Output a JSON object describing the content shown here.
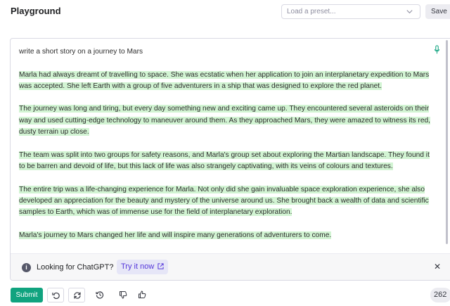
{
  "header": {
    "title": "Playground",
    "preset_placeholder": "Load a preset...",
    "save_label": "Save"
  },
  "editor": {
    "prompt": "write a short story on a journey to Mars",
    "paragraphs": [
      "Marla had always dreamt of travelling to space. She was ecstatic when her application to join an interplanetary expedition to Mars was accepted. She left Earth with a group of five adventurers in a ship that was designed to explore the red planet.",
      "The journey was long and tiring, but every day something new and exciting came up. They encountered several asteroids on their way and used cutting-edge technology to maneuver around them. As they approached Mars, they were amazed to witness its red, dusty terrain up close.",
      "The team was split into two groups for safety reasons, and Marla's group set about exploring the Martian landscape. They found it to be barren and devoid of life, but this lack of life was also strangely captivating, with its veins of colours and textures.",
      "The entire trip was a life-changing experience for Marla. Not only did she gain invaluable space exploration experience, she also developed an appreciation for the beauty and mystery of the universe around us. She brought back a wealth of data and scientific samples to Earth, which was of immense use for the field of interplanetary exploration.",
      "Marla's journey to Mars changed her life and will inspire many generations of adventurers to come."
    ],
    "highlight_color": "#d2f4d3"
  },
  "banner": {
    "text": "Looking for ChatGPT?",
    "link_label": "Try it now"
  },
  "footer": {
    "submit_label": "Submit",
    "token_count": "262"
  },
  "colors": {
    "accent": "#10a37f",
    "link": "#5436da"
  },
  "icons": [
    "chevron-down-icon",
    "microphone-icon",
    "info-icon",
    "external-link-icon",
    "close-icon",
    "undo-icon",
    "regenerate-icon",
    "history-icon",
    "thumbs-down-icon",
    "thumbs-up-icon"
  ]
}
